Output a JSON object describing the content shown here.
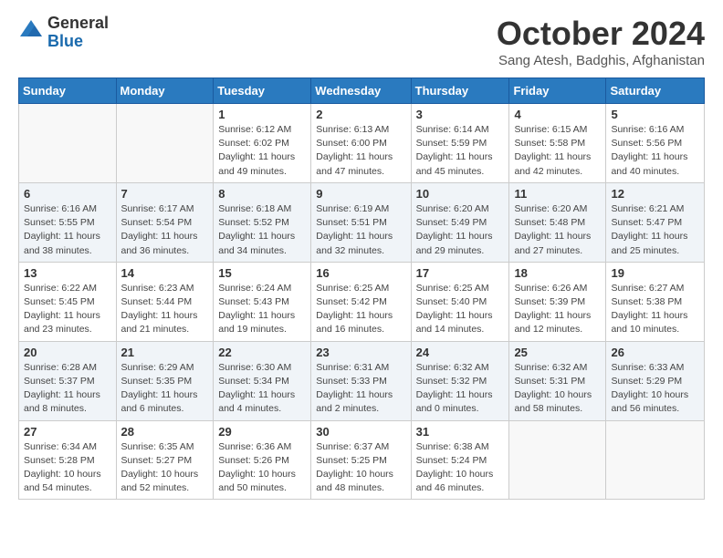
{
  "logo": {
    "general": "General",
    "blue": "Blue"
  },
  "title": "October 2024",
  "location": "Sang Atesh, Badghis, Afghanistan",
  "headers": [
    "Sunday",
    "Monday",
    "Tuesday",
    "Wednesday",
    "Thursday",
    "Friday",
    "Saturday"
  ],
  "weeks": [
    [
      {
        "day": "",
        "info": ""
      },
      {
        "day": "",
        "info": ""
      },
      {
        "day": "1",
        "info": "Sunrise: 6:12 AM\nSunset: 6:02 PM\nDaylight: 11 hours and 49 minutes."
      },
      {
        "day": "2",
        "info": "Sunrise: 6:13 AM\nSunset: 6:00 PM\nDaylight: 11 hours and 47 minutes."
      },
      {
        "day": "3",
        "info": "Sunrise: 6:14 AM\nSunset: 5:59 PM\nDaylight: 11 hours and 45 minutes."
      },
      {
        "day": "4",
        "info": "Sunrise: 6:15 AM\nSunset: 5:58 PM\nDaylight: 11 hours and 42 minutes."
      },
      {
        "day": "5",
        "info": "Sunrise: 6:16 AM\nSunset: 5:56 PM\nDaylight: 11 hours and 40 minutes."
      }
    ],
    [
      {
        "day": "6",
        "info": "Sunrise: 6:16 AM\nSunset: 5:55 PM\nDaylight: 11 hours and 38 minutes."
      },
      {
        "day": "7",
        "info": "Sunrise: 6:17 AM\nSunset: 5:54 PM\nDaylight: 11 hours and 36 minutes."
      },
      {
        "day": "8",
        "info": "Sunrise: 6:18 AM\nSunset: 5:52 PM\nDaylight: 11 hours and 34 minutes."
      },
      {
        "day": "9",
        "info": "Sunrise: 6:19 AM\nSunset: 5:51 PM\nDaylight: 11 hours and 32 minutes."
      },
      {
        "day": "10",
        "info": "Sunrise: 6:20 AM\nSunset: 5:49 PM\nDaylight: 11 hours and 29 minutes."
      },
      {
        "day": "11",
        "info": "Sunrise: 6:20 AM\nSunset: 5:48 PM\nDaylight: 11 hours and 27 minutes."
      },
      {
        "day": "12",
        "info": "Sunrise: 6:21 AM\nSunset: 5:47 PM\nDaylight: 11 hours and 25 minutes."
      }
    ],
    [
      {
        "day": "13",
        "info": "Sunrise: 6:22 AM\nSunset: 5:45 PM\nDaylight: 11 hours and 23 minutes."
      },
      {
        "day": "14",
        "info": "Sunrise: 6:23 AM\nSunset: 5:44 PM\nDaylight: 11 hours and 21 minutes."
      },
      {
        "day": "15",
        "info": "Sunrise: 6:24 AM\nSunset: 5:43 PM\nDaylight: 11 hours and 19 minutes."
      },
      {
        "day": "16",
        "info": "Sunrise: 6:25 AM\nSunset: 5:42 PM\nDaylight: 11 hours and 16 minutes."
      },
      {
        "day": "17",
        "info": "Sunrise: 6:25 AM\nSunset: 5:40 PM\nDaylight: 11 hours and 14 minutes."
      },
      {
        "day": "18",
        "info": "Sunrise: 6:26 AM\nSunset: 5:39 PM\nDaylight: 11 hours and 12 minutes."
      },
      {
        "day": "19",
        "info": "Sunrise: 6:27 AM\nSunset: 5:38 PM\nDaylight: 11 hours and 10 minutes."
      }
    ],
    [
      {
        "day": "20",
        "info": "Sunrise: 6:28 AM\nSunset: 5:37 PM\nDaylight: 11 hours and 8 minutes."
      },
      {
        "day": "21",
        "info": "Sunrise: 6:29 AM\nSunset: 5:35 PM\nDaylight: 11 hours and 6 minutes."
      },
      {
        "day": "22",
        "info": "Sunrise: 6:30 AM\nSunset: 5:34 PM\nDaylight: 11 hours and 4 minutes."
      },
      {
        "day": "23",
        "info": "Sunrise: 6:31 AM\nSunset: 5:33 PM\nDaylight: 11 hours and 2 minutes."
      },
      {
        "day": "24",
        "info": "Sunrise: 6:32 AM\nSunset: 5:32 PM\nDaylight: 11 hours and 0 minutes."
      },
      {
        "day": "25",
        "info": "Sunrise: 6:32 AM\nSunset: 5:31 PM\nDaylight: 10 hours and 58 minutes."
      },
      {
        "day": "26",
        "info": "Sunrise: 6:33 AM\nSunset: 5:29 PM\nDaylight: 10 hours and 56 minutes."
      }
    ],
    [
      {
        "day": "27",
        "info": "Sunrise: 6:34 AM\nSunset: 5:28 PM\nDaylight: 10 hours and 54 minutes."
      },
      {
        "day": "28",
        "info": "Sunrise: 6:35 AM\nSunset: 5:27 PM\nDaylight: 10 hours and 52 minutes."
      },
      {
        "day": "29",
        "info": "Sunrise: 6:36 AM\nSunset: 5:26 PM\nDaylight: 10 hours and 50 minutes."
      },
      {
        "day": "30",
        "info": "Sunrise: 6:37 AM\nSunset: 5:25 PM\nDaylight: 10 hours and 48 minutes."
      },
      {
        "day": "31",
        "info": "Sunrise: 6:38 AM\nSunset: 5:24 PM\nDaylight: 10 hours and 46 minutes."
      },
      {
        "day": "",
        "info": ""
      },
      {
        "day": "",
        "info": ""
      }
    ]
  ]
}
